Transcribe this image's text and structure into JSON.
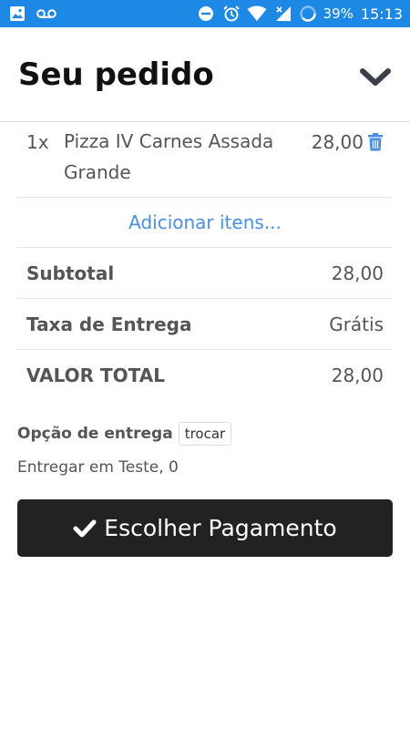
{
  "status_bar": {
    "battery": "39%",
    "time": "15:13"
  },
  "header": {
    "title": "Seu pedido"
  },
  "items": [
    {
      "qty": "1x",
      "name": "Pizza IV Carnes Assada Grande",
      "price": "28,00"
    }
  ],
  "add_items_label": "Adicionar itens...",
  "summary": [
    {
      "label": "Subtotal",
      "value": "28,00"
    },
    {
      "label": "Taxa de Entrega",
      "value": "Grátis"
    },
    {
      "label": "VALOR TOTAL",
      "value": "28,00"
    }
  ],
  "delivery": {
    "label": "Opção de entrega",
    "change_label": "trocar",
    "address": "Entregar em Teste, 0"
  },
  "pay_button": {
    "label": "Escolher Pagamento"
  },
  "colors": {
    "status_bar": "#1e88e5",
    "link": "#4a90e2",
    "pay_button": "#222222"
  }
}
